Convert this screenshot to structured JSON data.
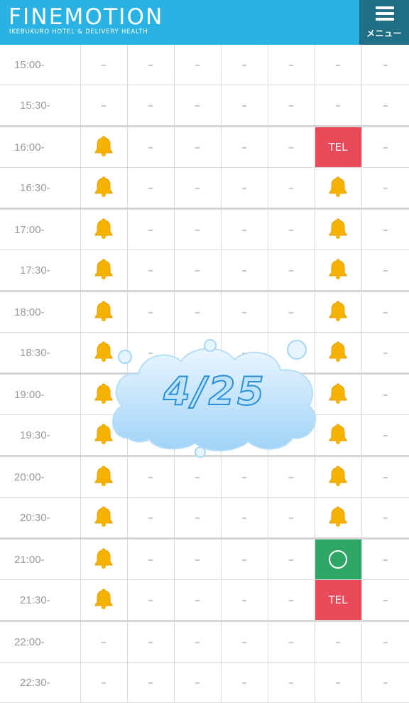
{
  "header": {
    "logo": "FINEMOTION",
    "subtitle": "IKEBUKURO HOTEL & DELIVERY HEALTH",
    "menu_label": "メニュー",
    "colors": {
      "bar": "#2ab2e4",
      "menu_bg": "#1f6f86"
    }
  },
  "overlay": {
    "date": "4/25"
  },
  "legend": {
    "dash": "–",
    "tel": "TEL",
    "bell_icon": "bell-icon",
    "ok_icon": "circle-icon"
  },
  "schedule": [
    {
      "time": "15:00-",
      "cells": [
        "dash",
        "dash",
        "dash",
        "dash",
        "dash",
        "dash",
        "dash"
      ]
    },
    {
      "time": "15:30-",
      "cells": [
        "dash",
        "dash",
        "dash",
        "dash",
        "dash",
        "dash",
        "dash"
      ]
    },
    {
      "time": "16:00-",
      "cells": [
        "bell",
        "dash",
        "dash",
        "dash",
        "dash",
        "tel",
        "dash"
      ]
    },
    {
      "time": "16:30-",
      "cells": [
        "bell",
        "dash",
        "dash",
        "dash",
        "dash",
        "bell",
        "dash"
      ]
    },
    {
      "time": "17:00-",
      "cells": [
        "bell",
        "dash",
        "dash",
        "dash",
        "dash",
        "bell",
        "dash"
      ]
    },
    {
      "time": "17:30-",
      "cells": [
        "bell",
        "dash",
        "dash",
        "dash",
        "dash",
        "bell",
        "dash"
      ]
    },
    {
      "time": "18:00-",
      "cells": [
        "bell",
        "dash",
        "dash",
        "dash",
        "dash",
        "bell",
        "dash"
      ]
    },
    {
      "time": "18:30-",
      "cells": [
        "bell",
        "dash",
        "dash",
        "dash",
        "dash",
        "bell",
        "dash"
      ]
    },
    {
      "time": "19:00-",
      "cells": [
        "bell",
        "dash",
        "dash",
        "dash",
        "dash",
        "bell",
        "dash"
      ]
    },
    {
      "time": "19:30-",
      "cells": [
        "bell",
        "dash",
        "dash",
        "dash",
        "dash",
        "bell",
        "dash"
      ]
    },
    {
      "time": "20:00-",
      "cells": [
        "bell",
        "dash",
        "dash",
        "dash",
        "dash",
        "bell",
        "dash"
      ]
    },
    {
      "time": "20:30-",
      "cells": [
        "bell",
        "dash",
        "dash",
        "dash",
        "dash",
        "bell",
        "dash"
      ]
    },
    {
      "time": "21:00-",
      "cells": [
        "bell",
        "dash",
        "dash",
        "dash",
        "dash",
        "ok",
        "dash"
      ]
    },
    {
      "time": "21:30-",
      "cells": [
        "bell",
        "dash",
        "dash",
        "dash",
        "dash",
        "tel",
        "dash"
      ]
    },
    {
      "time": "22:00-",
      "cells": [
        "dash",
        "dash",
        "dash",
        "dash",
        "dash",
        "dash",
        "dash"
      ]
    },
    {
      "time": "22:30-",
      "cells": [
        "dash",
        "dash",
        "dash",
        "dash",
        "dash",
        "dash",
        "dash"
      ]
    }
  ]
}
